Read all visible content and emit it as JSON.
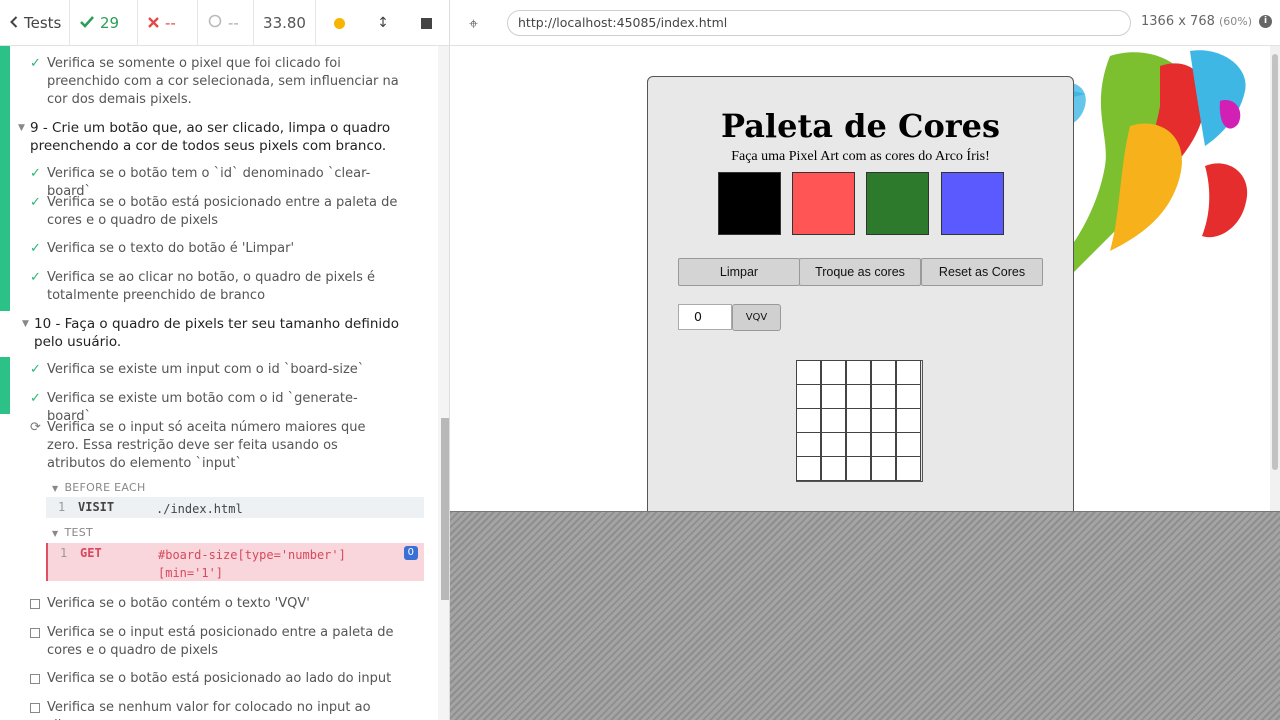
{
  "reporter": {
    "tests_label": "Tests",
    "passed_count": "29",
    "failed_count": "--",
    "pending_count": "--",
    "duration": "33.80"
  },
  "test_list": {
    "item_pixel_only": "Verifica se somente o pixel que foi clicado foi preenchido com a cor selecionada, sem influenciar na cor dos demais pixels.",
    "suite9_title": "9 - Crie um botão que, ao ser clicado, limpa o quadro preenchendo a cor de todos seus pixels com branco.",
    "suite9_tests": [
      "Verifica se o botão tem o `id` denominado `clear-board`",
      "Verifica se o botão está posicionado entre a paleta de cores e o quadro de pixels",
      "Verifica se o texto do botão é 'Limpar'",
      "Verifica se ao clicar no botão, o quadro de pixels é totalmente preenchido de branco"
    ],
    "suite10_title": "10 - Faça o quadro de pixels ter seu tamanho definido pelo usuário.",
    "suite10_passed": [
      "Verifica se existe um input com o id `board-size`",
      "Verifica se existe um botão com o id `generate-board`"
    ],
    "running_test": "Verifica se o input só aceita número maiores que zero. Essa restrição deve ser feita usando os atributos do elemento `input`",
    "before_each_label": "BEFORE EACH",
    "visit_cmd": {
      "num": "1",
      "name": "VISIT",
      "msg": "./index.html"
    },
    "test_label": "TEST",
    "get_cmd": {
      "num": "1",
      "name": "GET",
      "msg": "#board-size[type='number'][min='1']",
      "badge": "0"
    },
    "pending_tests": [
      "Verifica se o botão contém o texto 'VQV'",
      "Verifica se o input está posicionado entre a paleta de cores e o quadro de pixels",
      "Verifica se o botão está posicionado ao lado do input",
      "Verifica se nenhum valor for colocado no input ao clicar no"
    ]
  },
  "aut": {
    "url": "http://localhost:45085/index.html",
    "viewport": "1366 x 768",
    "zoom": "(60%)"
  },
  "app": {
    "title": "Paleta de Cores",
    "subtitle": "Faça uma Pixel Art com as cores do Arco Íris!",
    "palette_colors": [
      "#000000",
      "#ff5555",
      "#2d7a2d",
      "#5a5aff"
    ],
    "buttons": {
      "clear": "Limpar",
      "swap": "Troque as cores",
      "reset": "Reset as Cores"
    },
    "board_size_value": "0",
    "vqv_label": "VQV",
    "board_rows": 5,
    "board_cols": 5
  }
}
